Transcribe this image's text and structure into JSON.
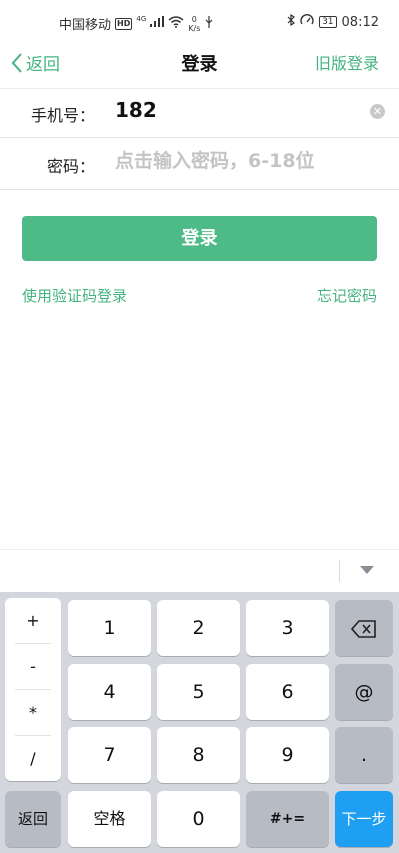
{
  "status_bar": {
    "carrier": "中国移动",
    "hd": "HD",
    "network": "4G",
    "speed_value": "0",
    "speed_unit": "K/s",
    "battery": "31",
    "time": "08:12"
  },
  "nav": {
    "back_label": "返回",
    "title": "登录",
    "old_version_label": "旧版登录"
  },
  "form": {
    "phone_label": "手机号：",
    "phone_value": "182",
    "password_label": "密码：",
    "password_placeholder": "点击输入密码，6-18位",
    "login_button": "登录",
    "sms_login_link": "使用验证码登录",
    "forgot_link": "忘记密码"
  },
  "keyboard": {
    "symbols": [
      "+",
      "-",
      "*",
      "/"
    ],
    "rows": [
      [
        "1",
        "2",
        "3"
      ],
      [
        "4",
        "5",
        "6"
      ],
      [
        "7",
        "8",
        "9"
      ]
    ],
    "right_keys": [
      "⌫",
      "@",
      "."
    ],
    "bottom": {
      "back": "返回",
      "space": "空格",
      "zero": "0",
      "symbols": "#+=",
      "next": "下一步"
    }
  },
  "colors": {
    "accent": "#44b382",
    "button": "#4dba87",
    "keyboard_bg": "#d3d6dc",
    "next_key": "#1e9ff2"
  }
}
